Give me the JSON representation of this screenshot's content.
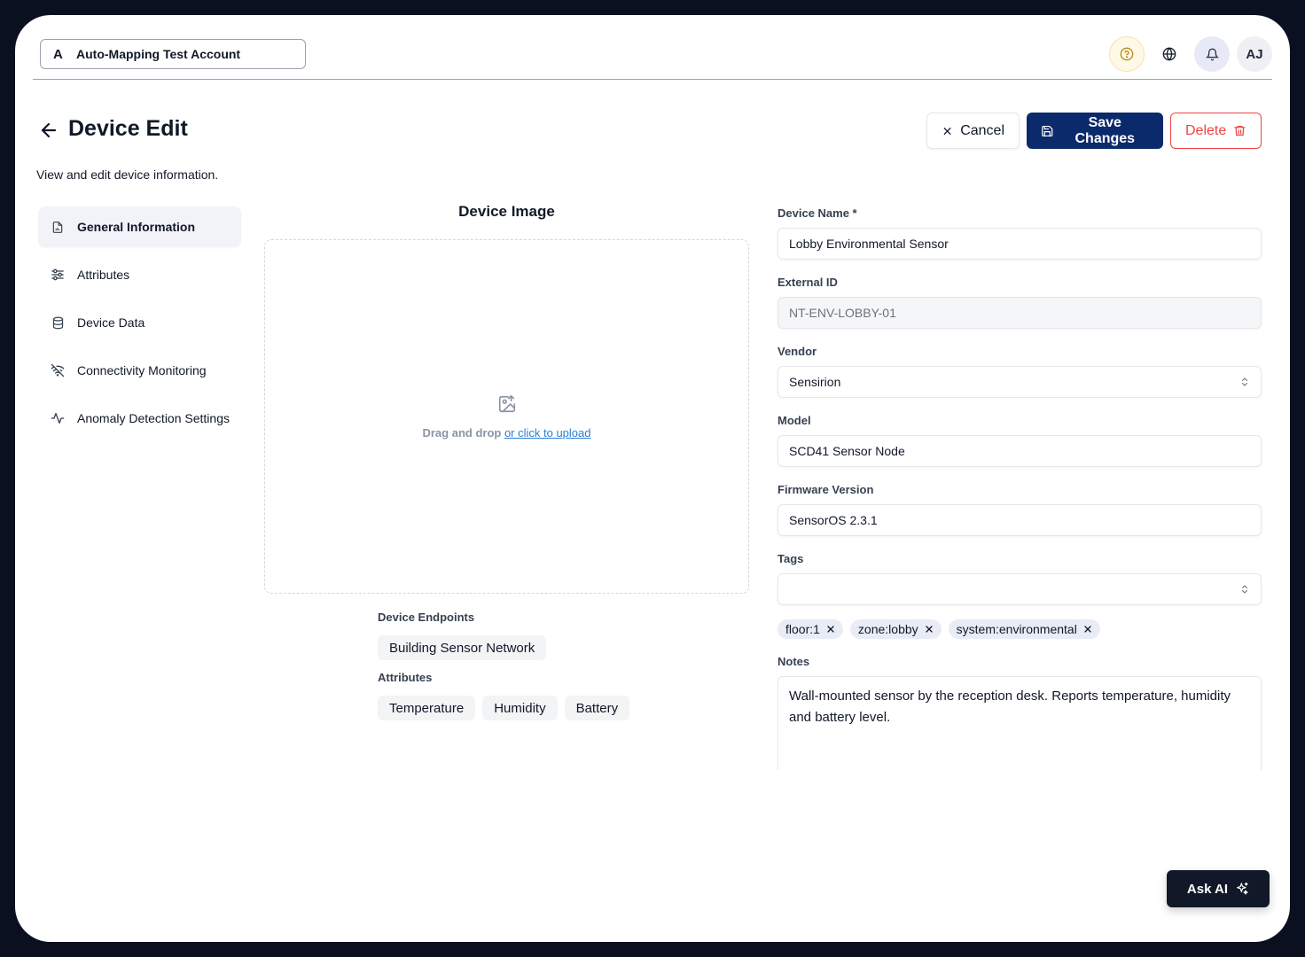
{
  "topbar": {
    "account_initial": "A",
    "account_name": "Auto-Mapping Test Account",
    "avatar_initials": "AJ"
  },
  "header": {
    "title": "Device Edit",
    "subtitle": "View and edit device information.",
    "cancel_label": "Cancel",
    "save_label": "Save Changes",
    "delete_label": "Delete"
  },
  "sidebar": {
    "items": [
      {
        "label": "General Information",
        "icon": "file-chart-icon"
      },
      {
        "label": "Attributes",
        "icon": "sliders-icon"
      },
      {
        "label": "Device Data",
        "icon": "database-icon"
      },
      {
        "label": "Connectivity Monitoring",
        "icon": "wifi-off-icon"
      },
      {
        "label": "Anomaly Detection Settings",
        "icon": "activity-icon"
      }
    ]
  },
  "image_panel": {
    "title": "Device Image",
    "drop_text": "Drag and drop ",
    "drop_link": "or click to upload"
  },
  "endpoints": {
    "label": "Device Endpoints",
    "items": [
      "Building Sensor Network"
    ]
  },
  "attributes": {
    "label": "Attributes",
    "items": [
      "Temperature",
      "Humidity",
      "Battery"
    ]
  },
  "form": {
    "device_name_label": "Device Name *",
    "device_name_value": "Lobby Environmental Sensor",
    "external_id_label": "External ID",
    "external_id_value": "NT-ENV-LOBBY-01",
    "vendor_label": "Vendor",
    "vendor_value": "Sensirion",
    "model_label": "Model",
    "model_value": "SCD41 Sensor Node",
    "firmware_label": "Firmware Version",
    "firmware_value": "SensorOS 2.3.1",
    "tags_label": "Tags",
    "tags": [
      "floor:1",
      "zone:lobby",
      "system:environmental"
    ],
    "notes_label": "Notes",
    "notes_value": "Wall-mounted sensor by the reception desk. Reports temperature, humidity and battery level."
  },
  "ask_ai_label": "Ask AI",
  "colors": {
    "primary": "#0b2a6b",
    "danger": "#ef4444",
    "link": "#2b7fd6"
  }
}
